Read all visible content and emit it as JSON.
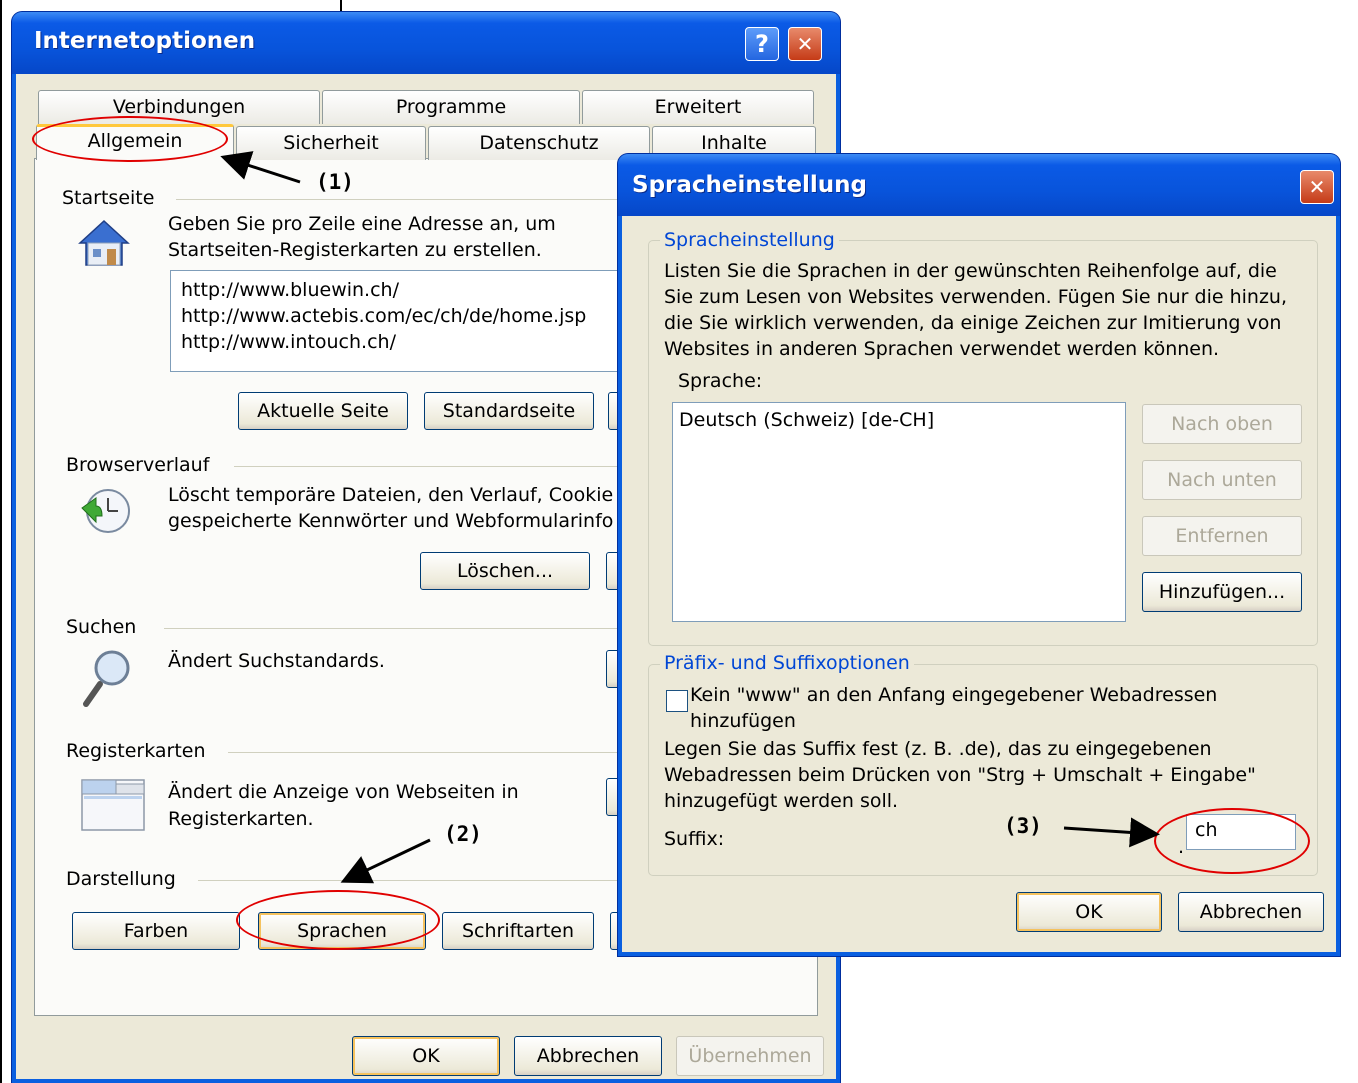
{
  "main_dialog": {
    "title": "Internetoptionen",
    "help_button": "?",
    "close_button": "✕",
    "tabs_row1": [
      "Verbindungen",
      "Programme",
      "Erweitert"
    ],
    "tabs_row2": [
      "Allgemein",
      "Sicherheit",
      "Datenschutz",
      "Inhalte"
    ],
    "active_tab": "Allgemein",
    "startseite": {
      "heading": "Startseite",
      "description_line1": "Geben Sie pro Zeile eine Adresse an, um",
      "description_line2": "Startseiten-Registerkarten zu erstellen.",
      "urls": [
        "http://www.bluewin.ch/",
        "http://www.actebis.com/ec/ch/de/home.jsp",
        "http://www.intouch.ch/"
      ],
      "btn_current": "Aktuelle Seite",
      "btn_default": "Standardseite"
    },
    "browserverlauf": {
      "heading": "Browserverlauf",
      "description_line1": "Löscht temporäre Dateien, den Verlauf, Cookie",
      "description_line2": "gespeicherte Kennwörter und Webformularinfo",
      "btn_delete": "Löschen..."
    },
    "suchen": {
      "heading": "Suchen",
      "description": "Ändert Suchstandards."
    },
    "registerkarten": {
      "heading": "Registerkarten",
      "description_line1": "Ändert die Anzeige von Webseiten in",
      "description_line2": "Registerkarten."
    },
    "darstellung": {
      "heading": "Darstellung",
      "btn_colors": "Farben",
      "btn_languages": "Sprachen",
      "btn_fonts": "Schriftarten"
    },
    "footer": {
      "ok": "OK",
      "cancel": "Abbrechen",
      "apply": "Übernehmen"
    }
  },
  "lang_dialog": {
    "title": "Spracheinstellung",
    "close_button": "✕",
    "group1_title": "Spracheinstellung",
    "intro_lines": [
      "Listen Sie die Sprachen in der gewünschten Reihenfolge auf, die",
      "Sie zum Lesen von Websites verwenden. Fügen Sie nur die hinzu,",
      "die Sie wirklich verwenden, da einige Zeichen zur Imitierung von",
      "Websites in anderen Sprachen verwendet werden können."
    ],
    "list_label": "Sprache:",
    "languages": [
      "Deutsch (Schweiz) [de-CH]"
    ],
    "btn_up": "Nach oben",
    "btn_down": "Nach unten",
    "btn_remove": "Entfernen",
    "btn_add": "Hinzufügen...",
    "group2_title": "Präfix- und Suffixoptionen",
    "checkbox_line1": "Kein \"www\" an den Anfang eingegebener Webadressen",
    "checkbox_line2": "hinzufügen",
    "checkbox_checked": false,
    "suffix_lines": [
      "Legen Sie das Suffix fest (z. B. .de), das zu eingegebenen",
      "Webadressen beim Drücken von \"Strg + Umschalt + Eingabe\"",
      "hinzugefügt werden soll."
    ],
    "suffix_label": "Suffix:",
    "suffix_dot": ".",
    "suffix_value": "ch",
    "ok": "OK",
    "cancel": "Abbrechen"
  },
  "annotations": {
    "a1": "(1)",
    "a2": "(2)",
    "a3": "(3)",
    "color": "#e00000"
  }
}
